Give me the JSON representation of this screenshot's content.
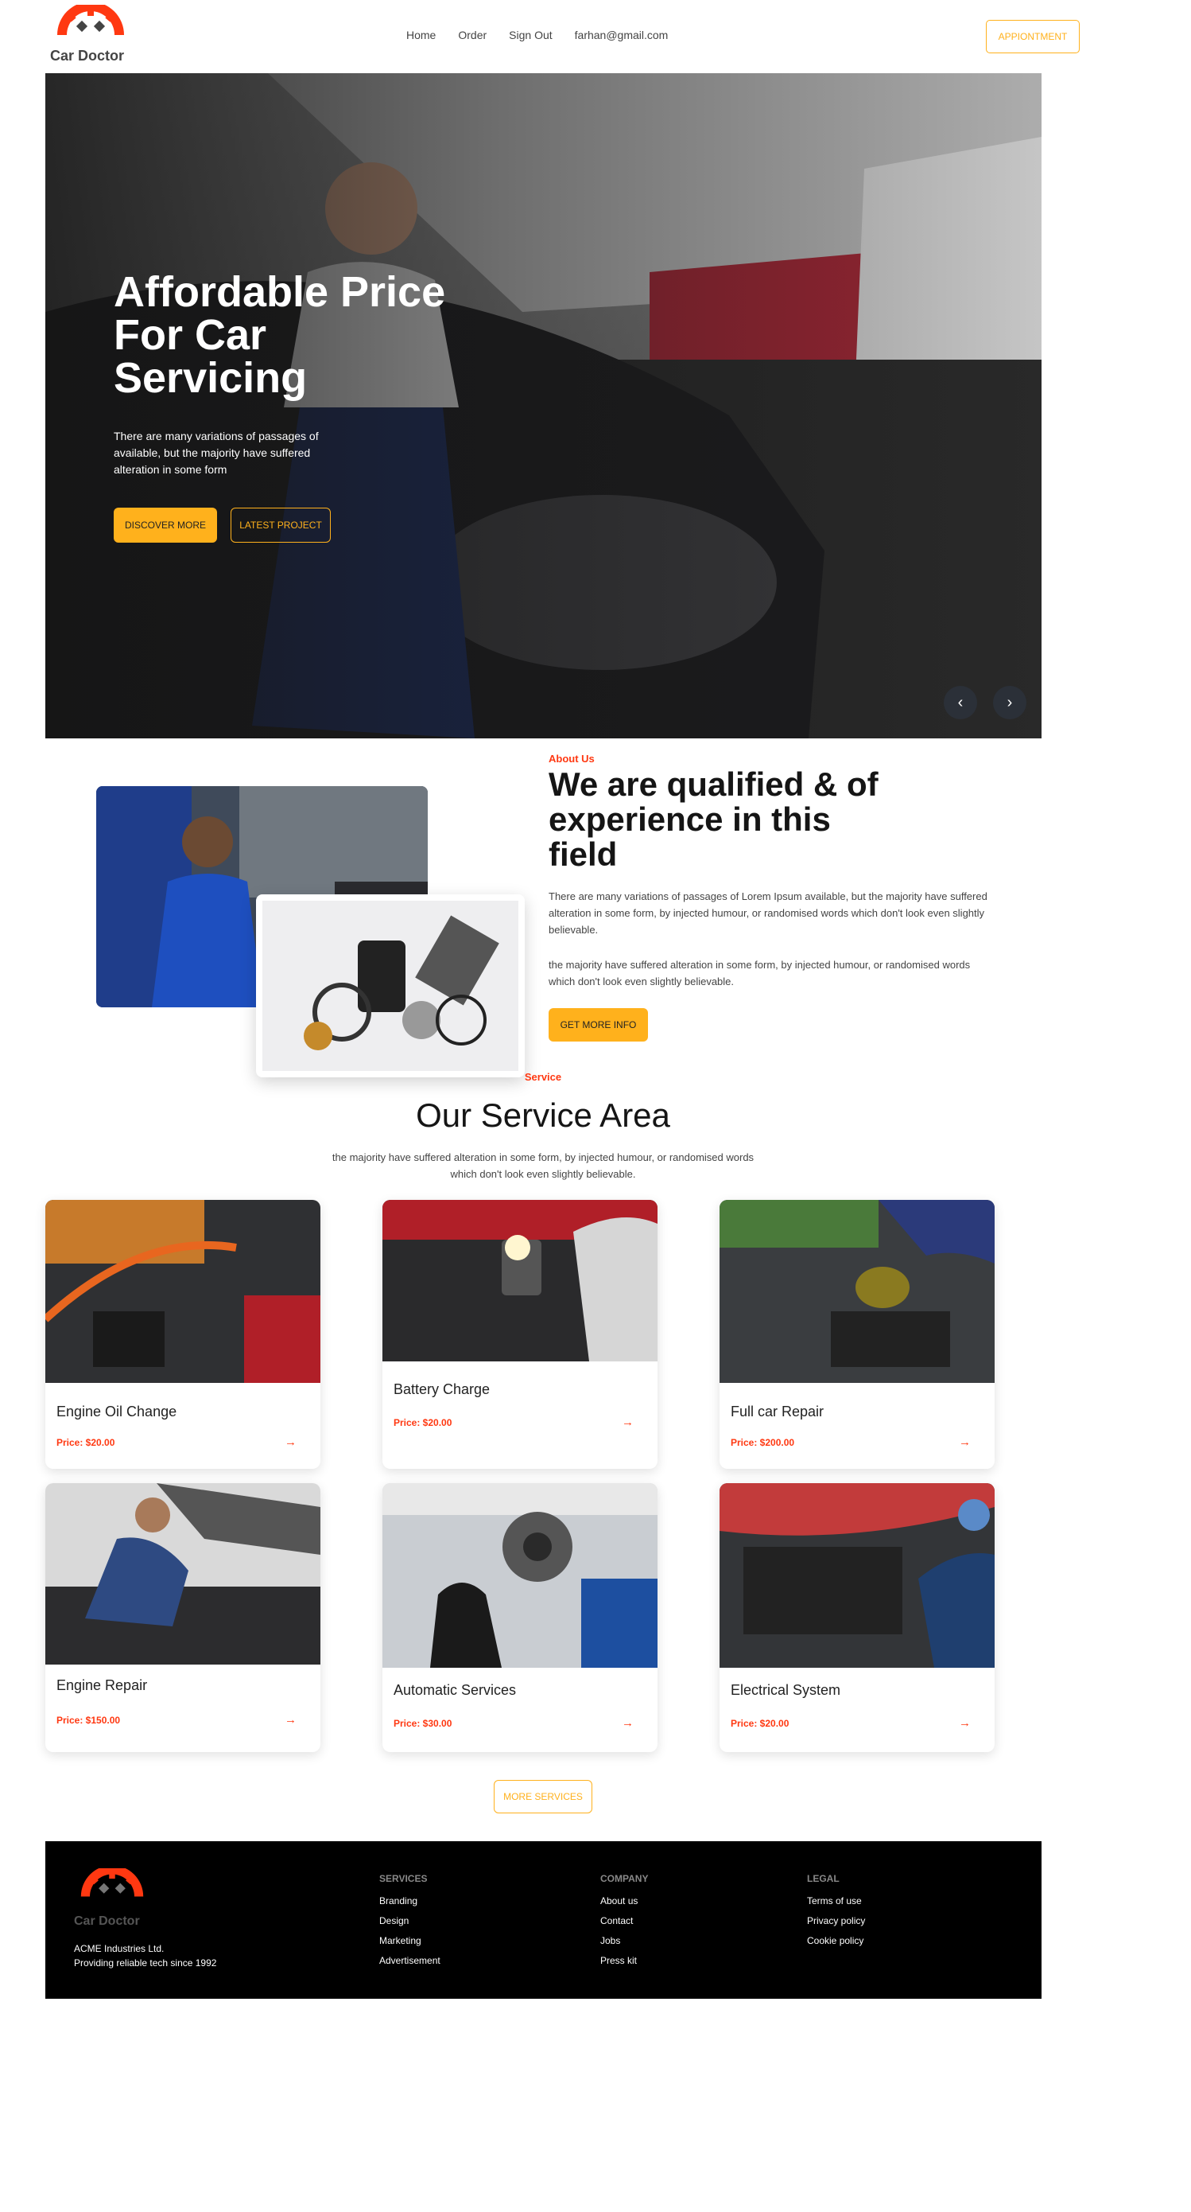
{
  "brand": {
    "name": "Car Doctor",
    "accent": "#FFB11C",
    "accent_red": "#FF3811",
    "logo_icon": "gear-wrench-logo"
  },
  "nav": {
    "items": [
      "Home",
      "Order",
      "Sign Out",
      "farhan@gmail.com"
    ],
    "appointment_label": "APPIONTMENT"
  },
  "hero": {
    "title": "Affordable Price For Car Servicing",
    "text": "There are many variations of passages of available, but the majority have suffered alteration in some form",
    "discover_label": "DISCOVER MORE",
    "latest_label": "LATEST PROJECT",
    "prev_icon": "‹",
    "next_icon": "›"
  },
  "about": {
    "kicker": "About Us",
    "title": "We are qualified & of experience in this field",
    "p1": "There are many variations of passages of Lorem Ipsum available, but the majority have suffered alteration in some form, by injected humour, or randomised words which don't look even slightly believable.",
    "p2": "the majority have suffered alteration in some form, by injected humour, or randomised words which don't look even slightly believable.",
    "button_label": "GET MORE INFO"
  },
  "services": {
    "kicker": "Service",
    "title": "Our Service Area",
    "subtitle": "the majority have suffered alteration in some form, by injected humour, or randomised words which don't look even slightly believable.",
    "items": [
      {
        "title": "Engine Oil Change",
        "price": "Price: $20.00"
      },
      {
        "title": "Battery Charge",
        "price": "Price: $20.00"
      },
      {
        "title": "Full car Repair",
        "price": "Price: $200.00"
      },
      {
        "title": "Engine Repair",
        "price": "Price: $150.00"
      },
      {
        "title": "Automatic Services",
        "price": "Price: $30.00"
      },
      {
        "title": "Electrical System",
        "price": "Price: $20.00"
      }
    ],
    "arrow_icon": "→",
    "more_label": "MORE SERVICES"
  },
  "footer": {
    "brand": "Car Doctor",
    "company_line1": "ACME Industries Ltd.",
    "company_line2": "Providing reliable tech since 1992",
    "columns": [
      {
        "title": "SERVICES",
        "links": [
          "Branding",
          "Design",
          "Marketing",
          "Advertisement"
        ]
      },
      {
        "title": "COMPANY",
        "links": [
          "About us",
          "Contact",
          "Jobs",
          "Press kit"
        ]
      },
      {
        "title": "LEGAL",
        "links": [
          "Terms of use",
          "Privacy policy",
          "Cookie policy"
        ]
      }
    ]
  }
}
